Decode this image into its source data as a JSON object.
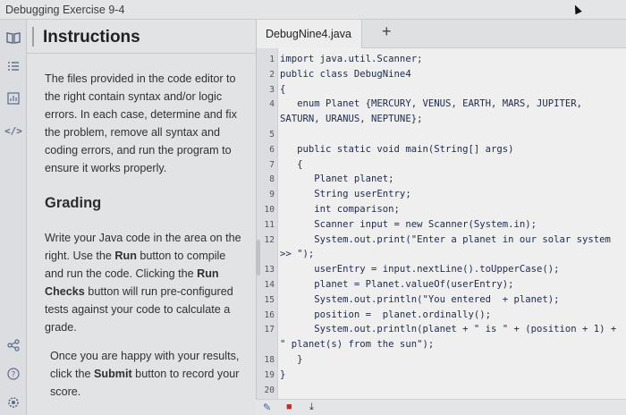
{
  "window": {
    "title": "Debugging Exercise 9-4"
  },
  "rail": {
    "icons": [
      "book-icon",
      "list-icon",
      "chart-icon",
      "code-icon",
      "share-icon",
      "help-icon",
      "settings-icon"
    ]
  },
  "instructions": {
    "title": "Instructions",
    "intro": "The files provided in the code editor to the right contain syntax and/or logic errors. In each case, determine and fix the problem, remove all syntax and coding errors, and run the program to ensure it works properly.",
    "grading_title": "Grading",
    "grading_p1_a": "Write your Java code in the area on the right. Use the ",
    "grading_p1_run": "Run",
    "grading_p1_b": " button to compile and run the code. Clicking the ",
    "grading_p1_checks": "Run Checks",
    "grading_p1_c": " button will run pre-configured tests against your code to calculate a grade.",
    "grading_p2_a": "Once you are happy with your results, click the ",
    "grading_p2_submit": "Submit",
    "grading_p2_b": " button to record your score."
  },
  "editor": {
    "tab": "DebugNine4.java",
    "add_tab": "+",
    "lines": [
      {
        "n": "1",
        "t": "import java.util.Scanner;"
      },
      {
        "n": "2",
        "t": "public class DebugNine4"
      },
      {
        "n": "3",
        "t": "{"
      },
      {
        "n": "4",
        "t": "   enum Planet {MERCURY, VENUS, EARTH, MARS, JUPITER,"
      },
      {
        "n": "",
        "t": "SATURN, URANUS, NEPTUNE};"
      },
      {
        "n": "5",
        "t": ""
      },
      {
        "n": "6",
        "t": "   public static void main(String[] args)"
      },
      {
        "n": "7",
        "t": "   {"
      },
      {
        "n": "8",
        "t": "      Planet planet;"
      },
      {
        "n": "9",
        "t": "      String userEntry;"
      },
      {
        "n": "10",
        "t": "      int comparison;"
      },
      {
        "n": "11",
        "t": "      Scanner input = new Scanner(System.in);"
      },
      {
        "n": "12",
        "t": "      System.out.print(\"Enter a planet in our solar system"
      },
      {
        "n": "",
        "t": ">> \");"
      },
      {
        "n": "13",
        "t": "      userEntry = input.nextLine().toUpperCase();"
      },
      {
        "n": "14",
        "t": "      planet = Planet.valueOf(userEntry);"
      },
      {
        "n": "15",
        "t": "      System.out.println(\"You entered  + planet);"
      },
      {
        "n": "16",
        "t": "      position =  planet.ordinally();"
      },
      {
        "n": "17",
        "t": "      System.out.println(planet + \" is \" + (position + 1) +"
      },
      {
        "n": "",
        "t": "\" planet(s) from the sun\");"
      },
      {
        "n": "18",
        "t": "   }"
      },
      {
        "n": "19",
        "t": "}"
      },
      {
        "n": "20",
        "t": ""
      }
    ]
  }
}
